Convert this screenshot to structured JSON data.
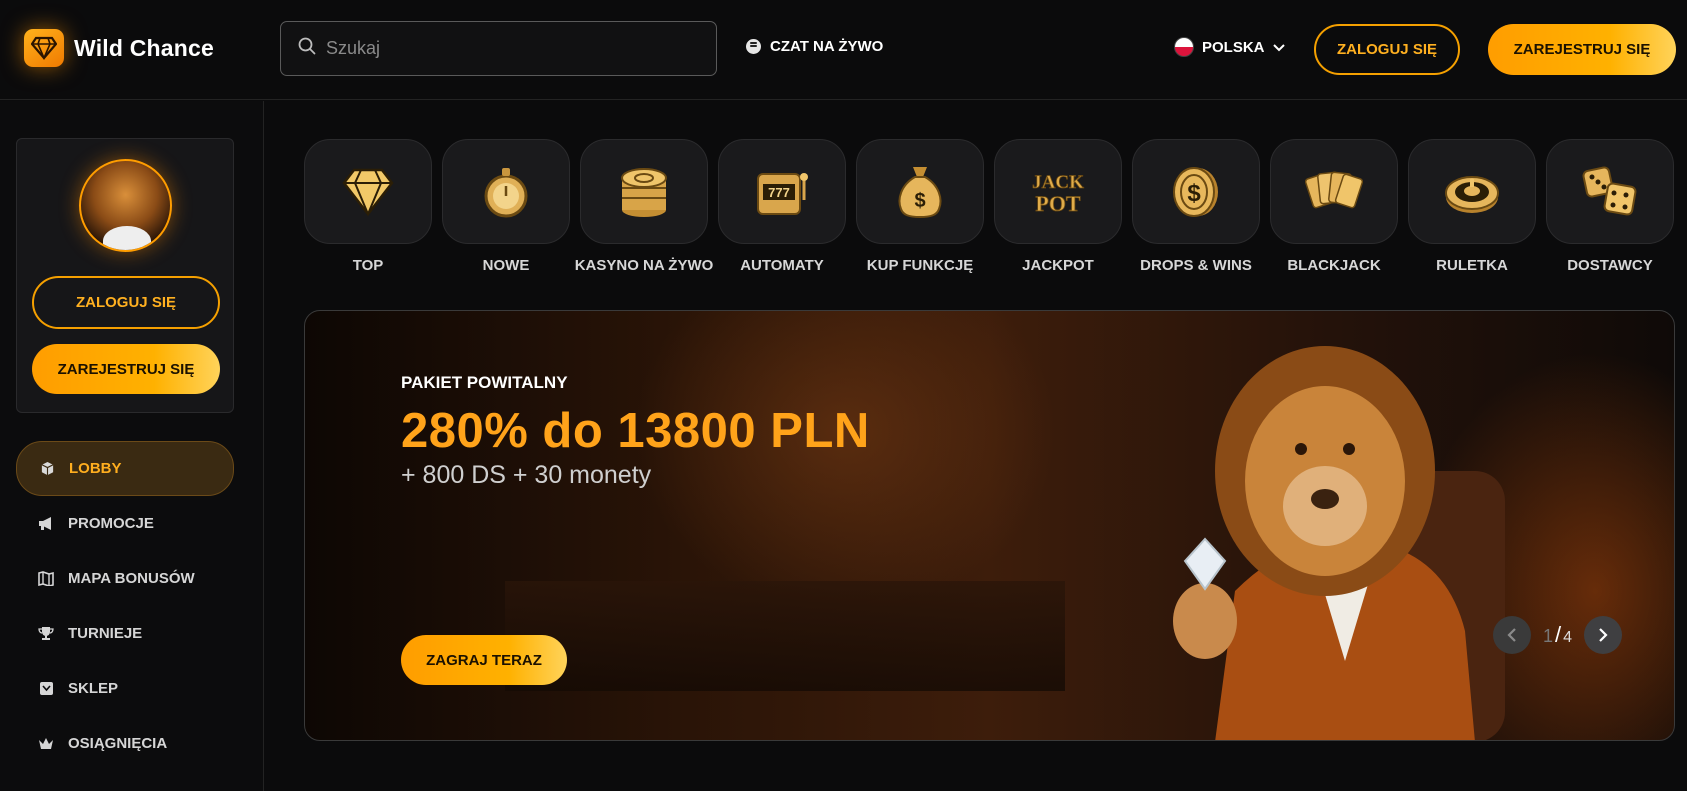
{
  "header": {
    "logo_text": "Wild Chance",
    "search_placeholder": "Szukaj",
    "live_chat": "CZAT NA ŻYWO",
    "language": "POLSKA",
    "login": "ZALOGUJ SIĘ",
    "register": "ZAREJESTRUJ SIĘ"
  },
  "sidebar": {
    "login": "ZALOGUJ SIĘ",
    "register": "ZAREJESTRUJ SIĘ",
    "menu": [
      {
        "label": "LOBBY",
        "icon": "cube-icon",
        "active": true
      },
      {
        "label": "PROMOCJE",
        "icon": "megaphone-icon",
        "active": false
      },
      {
        "label": "MAPA BONUSÓW",
        "icon": "map-icon",
        "active": false
      },
      {
        "label": "TURNIEJE",
        "icon": "trophy-icon",
        "active": false
      },
      {
        "label": "SKLEP",
        "icon": "shop-icon",
        "active": false
      },
      {
        "label": "OSIĄGNIĘCIA",
        "icon": "crown-icon",
        "active": false
      }
    ]
  },
  "categories": [
    {
      "label": "TOP",
      "icon": "diamond-icon"
    },
    {
      "label": "NOWE",
      "icon": "stopwatch-icon"
    },
    {
      "label": "KASYNO NA ŻYWO",
      "icon": "chips-icon"
    },
    {
      "label": "AUTOMATY",
      "icon": "slot-machine-icon"
    },
    {
      "label": "KUP FUNKCJĘ",
      "icon": "money-bag-icon"
    },
    {
      "label": "JACKPOT",
      "icon": "jackpot-icon"
    },
    {
      "label": "DROPS & WINS",
      "icon": "dollar-coin-icon"
    },
    {
      "label": "BLACKJACK",
      "icon": "playing-cards-icon"
    },
    {
      "label": "RULETKA",
      "icon": "roulette-icon"
    },
    {
      "label": "DOSTAWCY",
      "icon": "dice-icon"
    }
  ],
  "jackpot_icon_text": {
    "line1": "JACK",
    "line2": "POT"
  },
  "banner": {
    "kicker": "PAKIET POWITALNY",
    "title": "280% do 13800 PLN",
    "subtitle": "+ 800 DS + 30 monety",
    "cta": "ZAGRAJ TERAZ",
    "page_current": "1",
    "page_separator": "/",
    "page_total": "4"
  },
  "colors": {
    "accent": "#ffa31a",
    "background": "#0b0b0c",
    "tile": "#1a1a1c"
  }
}
